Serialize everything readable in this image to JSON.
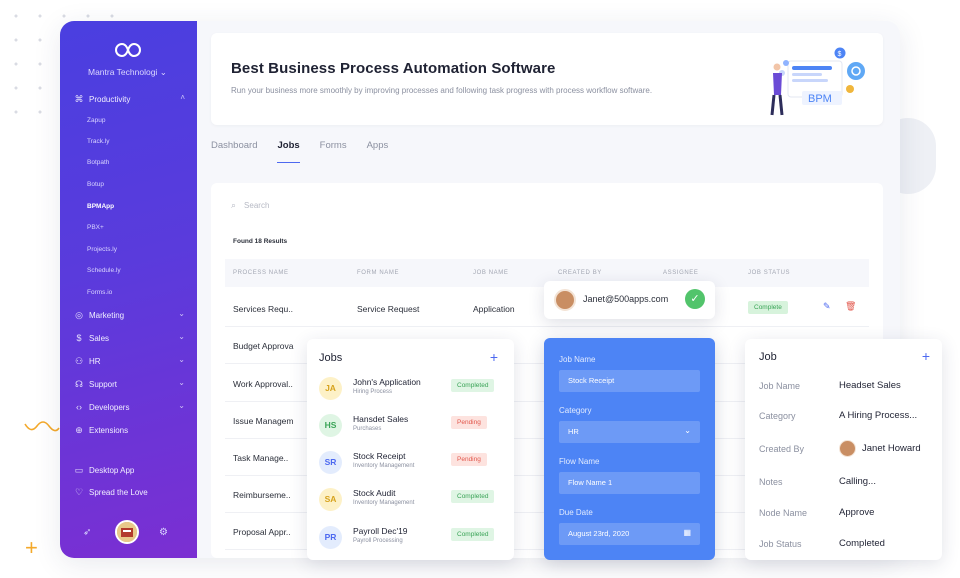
{
  "sidebar": {
    "company": "Mantra Technologi",
    "groups": {
      "productivity": "Productivity",
      "marketing": "Marketing",
      "sales": "Sales",
      "hr": "HR",
      "support": "Support",
      "developers": "Developers",
      "extensions": "Extensions",
      "desktop_app": "Desktop App",
      "spread_love": "Spread the Love"
    },
    "apps": [
      "Zapup",
      "Track.ly",
      "Botpath",
      "Botup",
      "BPMApp",
      "PBX+",
      "Projects.ly",
      "Schedule.ly",
      "Forms.io"
    ],
    "icons": {
      "logo": "infinity-logo-icon",
      "productivity": "command-icon",
      "marketing": "target-icon",
      "sales": "dollar-icon",
      "hr": "users-icon",
      "support": "headset-icon",
      "developers": "code-icon",
      "extensions": "globe-icon",
      "desktop": "monitor-icon",
      "love": "heart-icon",
      "rocket": "rocket-icon",
      "settings": "gear-icon"
    }
  },
  "hero": {
    "title": "Best Business Process Automation Software",
    "subtitle": "Run your business more smoothly by improving processes and following task progress with process workflow software.",
    "illustration_label": "BPM",
    "illustration_coin": "$"
  },
  "tabs": [
    "Dashboard",
    "Jobs",
    "Forms",
    "Apps"
  ],
  "table": {
    "search_placeholder": "Search",
    "found_text": "Found 18 Results",
    "headers": [
      "PROCESS NAME",
      "FORM NAME",
      "JOB NAME",
      "CREATED BY",
      "ASSIGNEE",
      "JOB STATUS"
    ],
    "rows": [
      {
        "process": "Services Requ..",
        "form": "Service Request",
        "job": "Application",
        "status": "Complete"
      },
      {
        "process": "Budget Approva"
      },
      {
        "process": "Work Approval.."
      },
      {
        "process": "Issue Managem"
      },
      {
        "process": "Task Manage.."
      },
      {
        "process": "Reimburseme.."
      },
      {
        "process": "Proposal Appr.."
      }
    ]
  },
  "email_popup": {
    "email": "Janet@500apps.com",
    "check": "✓"
  },
  "jobs_card": {
    "title": "Jobs",
    "add": "+",
    "items": [
      {
        "initials": "JA",
        "name": "John's Application",
        "sub": "Hiring Process",
        "status": "Completed",
        "bg": "#fdf1c7",
        "fg": "#d6a21c"
      },
      {
        "initials": "HS",
        "name": "Hansdet Sales",
        "sub": "Purchases",
        "status": "Pending",
        "bg": "#dff5e4",
        "fg": "#3aa457"
      },
      {
        "initials": "SR",
        "name": "Stock Receipt",
        "sub": "Inventory Management",
        "status": "Pending",
        "bg": "#e3ecfd",
        "fg": "#4d69f0"
      },
      {
        "initials": "SA",
        "name": "Stock Audit",
        "sub": "Inventory Management",
        "status": "Completed",
        "bg": "#fdf1c7",
        "fg": "#d6a21c"
      },
      {
        "initials": "PR",
        "name": "Payroll Dec'19",
        "sub": "Payroll Processing",
        "status": "Completed",
        "bg": "#e3ecfd",
        "fg": "#4d69f0"
      }
    ]
  },
  "form_card": {
    "job_name_label": "Job Name",
    "job_name_value": "Stock Receipt",
    "category_label": "Category",
    "category_value": "HR",
    "flow_label": "Flow Name",
    "flow_value": "Flow Name 1",
    "due_label": "Due Date",
    "due_value": "August 23rd, 2020"
  },
  "detail_card": {
    "title": "Job",
    "add": "+",
    "fields": [
      {
        "label": "Job Name",
        "value": "Headset Sales"
      },
      {
        "label": "Category",
        "value": "A Hiring Process..."
      },
      {
        "label": "Created By",
        "value": "Janet Howard"
      },
      {
        "label": "Notes",
        "value": "Calling..."
      },
      {
        "label": "Node Name",
        "value": "Approve"
      },
      {
        "label": "Job Status",
        "value": "Completed"
      }
    ]
  },
  "colors": {
    "accent": "#4d69f0",
    "sidebar_start": "#4a3fe0",
    "sidebar_end": "#7b2fd2",
    "form_card": "#4d84f5",
    "success": "#3aa457",
    "danger": "#e2574c"
  }
}
